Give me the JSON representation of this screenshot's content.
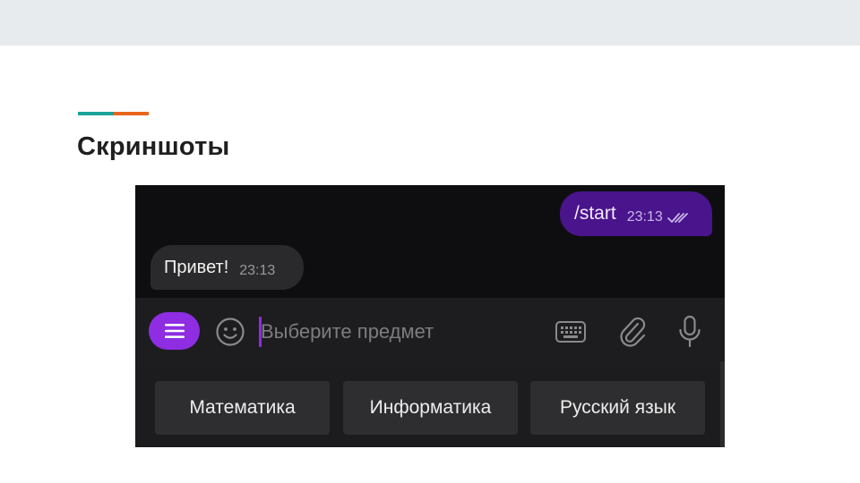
{
  "slide": {
    "title": "Скриншоты",
    "accent_colors": [
      "#1aa39a",
      "#e8661c"
    ]
  },
  "chat": {
    "outgoing": {
      "text": "/start",
      "time": "23:13",
      "status_icon": "double-check-icon",
      "bubble_color": "#4a148c"
    },
    "incoming": {
      "text": "Привет!",
      "time": "23:13",
      "bubble_color": "#2a2a2c"
    }
  },
  "input_bar": {
    "menu_icon": "menu-icon",
    "menu_color": "#8e2de2",
    "emoji_icon": "smile-icon",
    "placeholder": "Выберите предмет",
    "cursor_color": "#8e2de2",
    "keyboard_icon": "keyboard-icon",
    "attach_icon": "paperclip-icon",
    "mic_icon": "microphone-icon"
  },
  "reply_keyboard": {
    "options": [
      "Математика",
      "Информатика",
      "Русский язык"
    ]
  }
}
